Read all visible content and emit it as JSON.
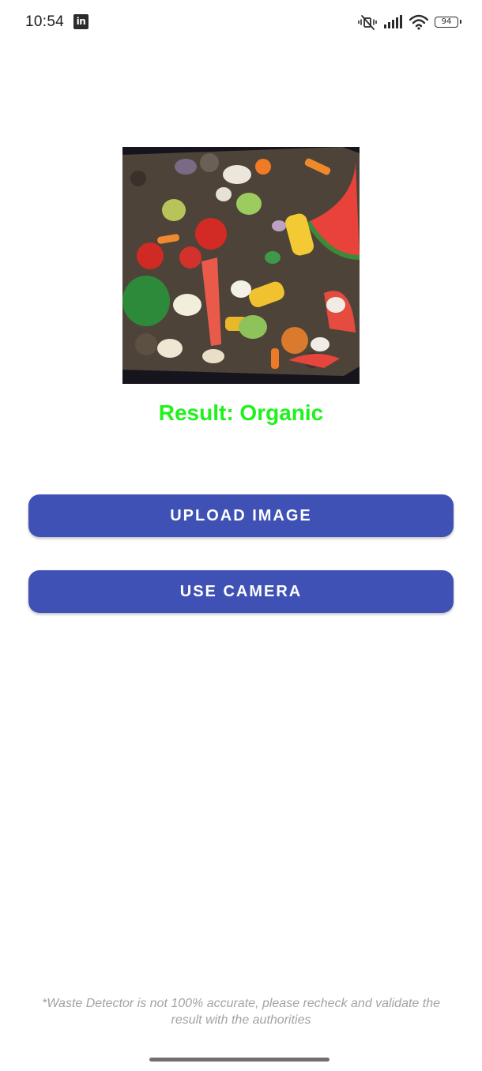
{
  "status_bar": {
    "time": "10:54",
    "notification_icon": "linkedin-icon",
    "notification_glyph": "in",
    "icons": [
      "mute-vibrate-icon",
      "signal-icon",
      "wifi-icon",
      "battery-icon"
    ],
    "battery_level": "94"
  },
  "main": {
    "image_description_icon": "organic-waste-photo",
    "result": "Result: Organic",
    "result_color": "#1ff21a",
    "upload_label": "UPLOAD IMAGE",
    "camera_label": "USE CAMERA",
    "button_color": "#3f51b5",
    "disclaimer": "*Waste Detector is not 100% accurate, please recheck and validate the result with the authorities"
  }
}
